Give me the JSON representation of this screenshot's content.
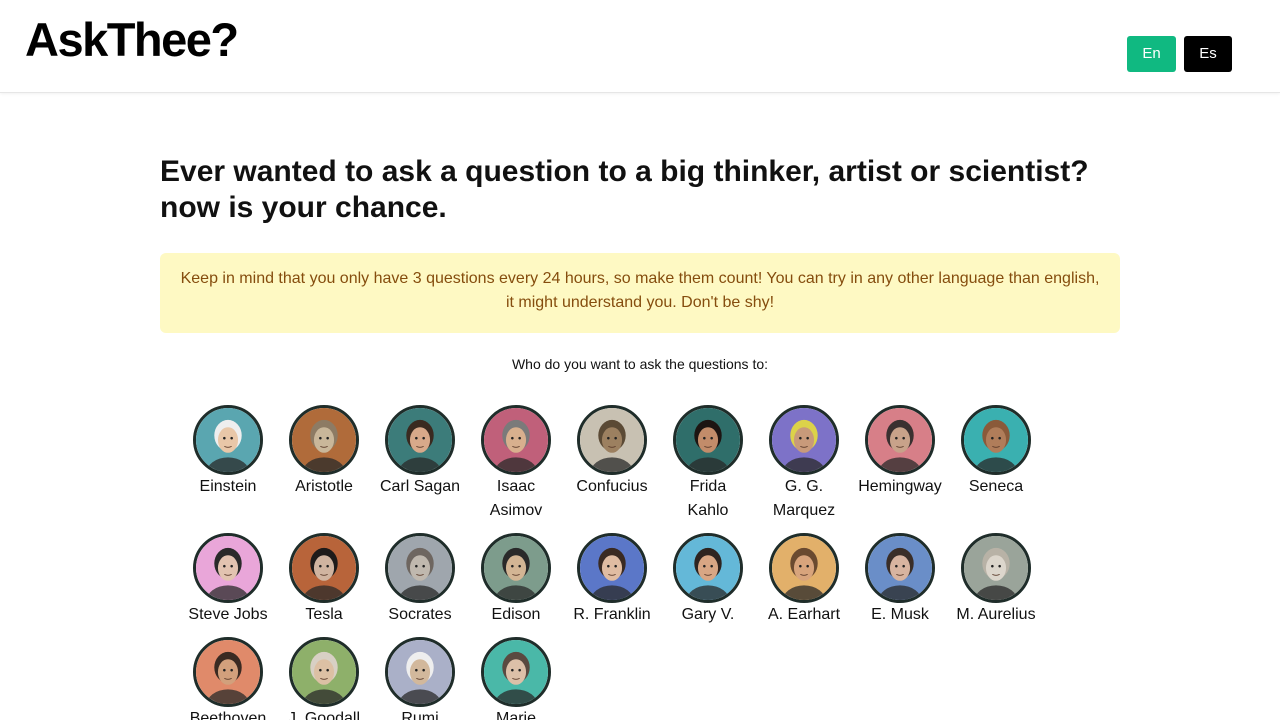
{
  "header": {
    "logo": "AskThee?",
    "lang_en": "En",
    "lang_es": "Es"
  },
  "main": {
    "headline": "Ever wanted to ask a question to a big thinker, artist or scientist? now is your chance.",
    "notice": "Keep in mind that you only have 3 questions every 24 hours, so make them count!  You can try in any other language than english, it might understand you. Don't be shy!",
    "prompt": "Who do you want to ask the questions to:"
  },
  "thinkers": [
    {
      "name": "Einstein",
      "bg": "#5aa6b0",
      "face": "#e8c7a8",
      "hair": "#eeeeee"
    },
    {
      "name": "Aristotle",
      "bg": "#b06b3a",
      "face": "#c9b79a",
      "hair": "#8d7b64"
    },
    {
      "name": "Carl Sagan",
      "bg": "#3c7c7a",
      "face": "#d8a98a",
      "hair": "#3a2a20"
    },
    {
      "name": "Isaac Asimov",
      "bg": "#c0607a",
      "face": "#d8b08e",
      "hair": "#7a7a7a"
    },
    {
      "name": "Confucius",
      "bg": "#c8c1b2",
      "face": "#9c8060",
      "hair": "#5b4a35"
    },
    {
      "name": "Frida Kahlo",
      "bg": "#2f6e6a",
      "face": "#c28c6a",
      "hair": "#1d1512"
    },
    {
      "name": "G. G. Marquez",
      "bg": "#7d72c8",
      "face": "#c89a7a",
      "hair": "#dcd24a"
    },
    {
      "name": "Hemingway",
      "bg": "#d77f88",
      "face": "#c8a28a",
      "hair": "#3a3030"
    },
    {
      "name": "Seneca",
      "bg": "#3ab0b0",
      "face": "#b07d5a",
      "hair": "#8a5a3a"
    },
    {
      "name": "Steve Jobs",
      "bg": "#e9a6d9",
      "face": "#e2c3b0",
      "hair": "#2a2a2a"
    },
    {
      "name": "Tesla",
      "bg": "#b8643a",
      "face": "#d0b4a0",
      "hair": "#1e1b1a"
    },
    {
      "name": "Socrates",
      "bg": "#9fa6ad",
      "face": "#c0b8ae",
      "hair": "#6e6660"
    },
    {
      "name": "Edison",
      "bg": "#7d9c8c",
      "face": "#d3b594",
      "hair": "#2a2a2a"
    },
    {
      "name": "R. Franklin",
      "bg": "#5b77c8",
      "face": "#e0bca2",
      "hair": "#3a2a22"
    },
    {
      "name": "Gary V.",
      "bg": "#64b8d8",
      "face": "#d8a684",
      "hair": "#2e2420"
    },
    {
      "name": "A. Earhart",
      "bg": "#e2b06a",
      "face": "#d8a47c",
      "hair": "#6a4a30"
    },
    {
      "name": "E. Musk",
      "bg": "#6a8ec8",
      "face": "#d8b4a0",
      "hair": "#3a2e28"
    },
    {
      "name": "M. Aurelius",
      "bg": "#9aa49a",
      "face": "#dcd6cc",
      "hair": "#b8b2a6"
    },
    {
      "name": "Beethoven",
      "bg": "#e08a6a",
      "face": "#d2a07c",
      "hair": "#3a2a22"
    },
    {
      "name": "J. Goodall",
      "bg": "#8eb06a",
      "face": "#dcc0a4",
      "hair": "#d8d0c4"
    },
    {
      "name": "Rumi",
      "bg": "#aab0c8",
      "face": "#d2b89c",
      "hair": "#eeeeee"
    },
    {
      "name": "Marie",
      "bg": "#4ab8a8",
      "face": "#dcc0a8",
      "hair": "#5a4a40"
    }
  ]
}
